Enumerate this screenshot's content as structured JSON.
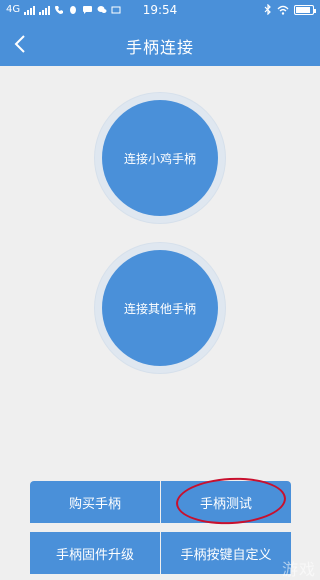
{
  "status_bar": {
    "network": "4G",
    "time": "19:54"
  },
  "nav": {
    "title": "手柄连接"
  },
  "main": {
    "connect_xiaoji": "连接小鸡手柄",
    "connect_other": "连接其他手柄"
  },
  "bottom": {
    "buy": "购买手柄",
    "test": "手柄测试",
    "firmware": "手柄固件升级",
    "custom_keys": "手柄按键自定义"
  },
  "watermark": "游戏"
}
